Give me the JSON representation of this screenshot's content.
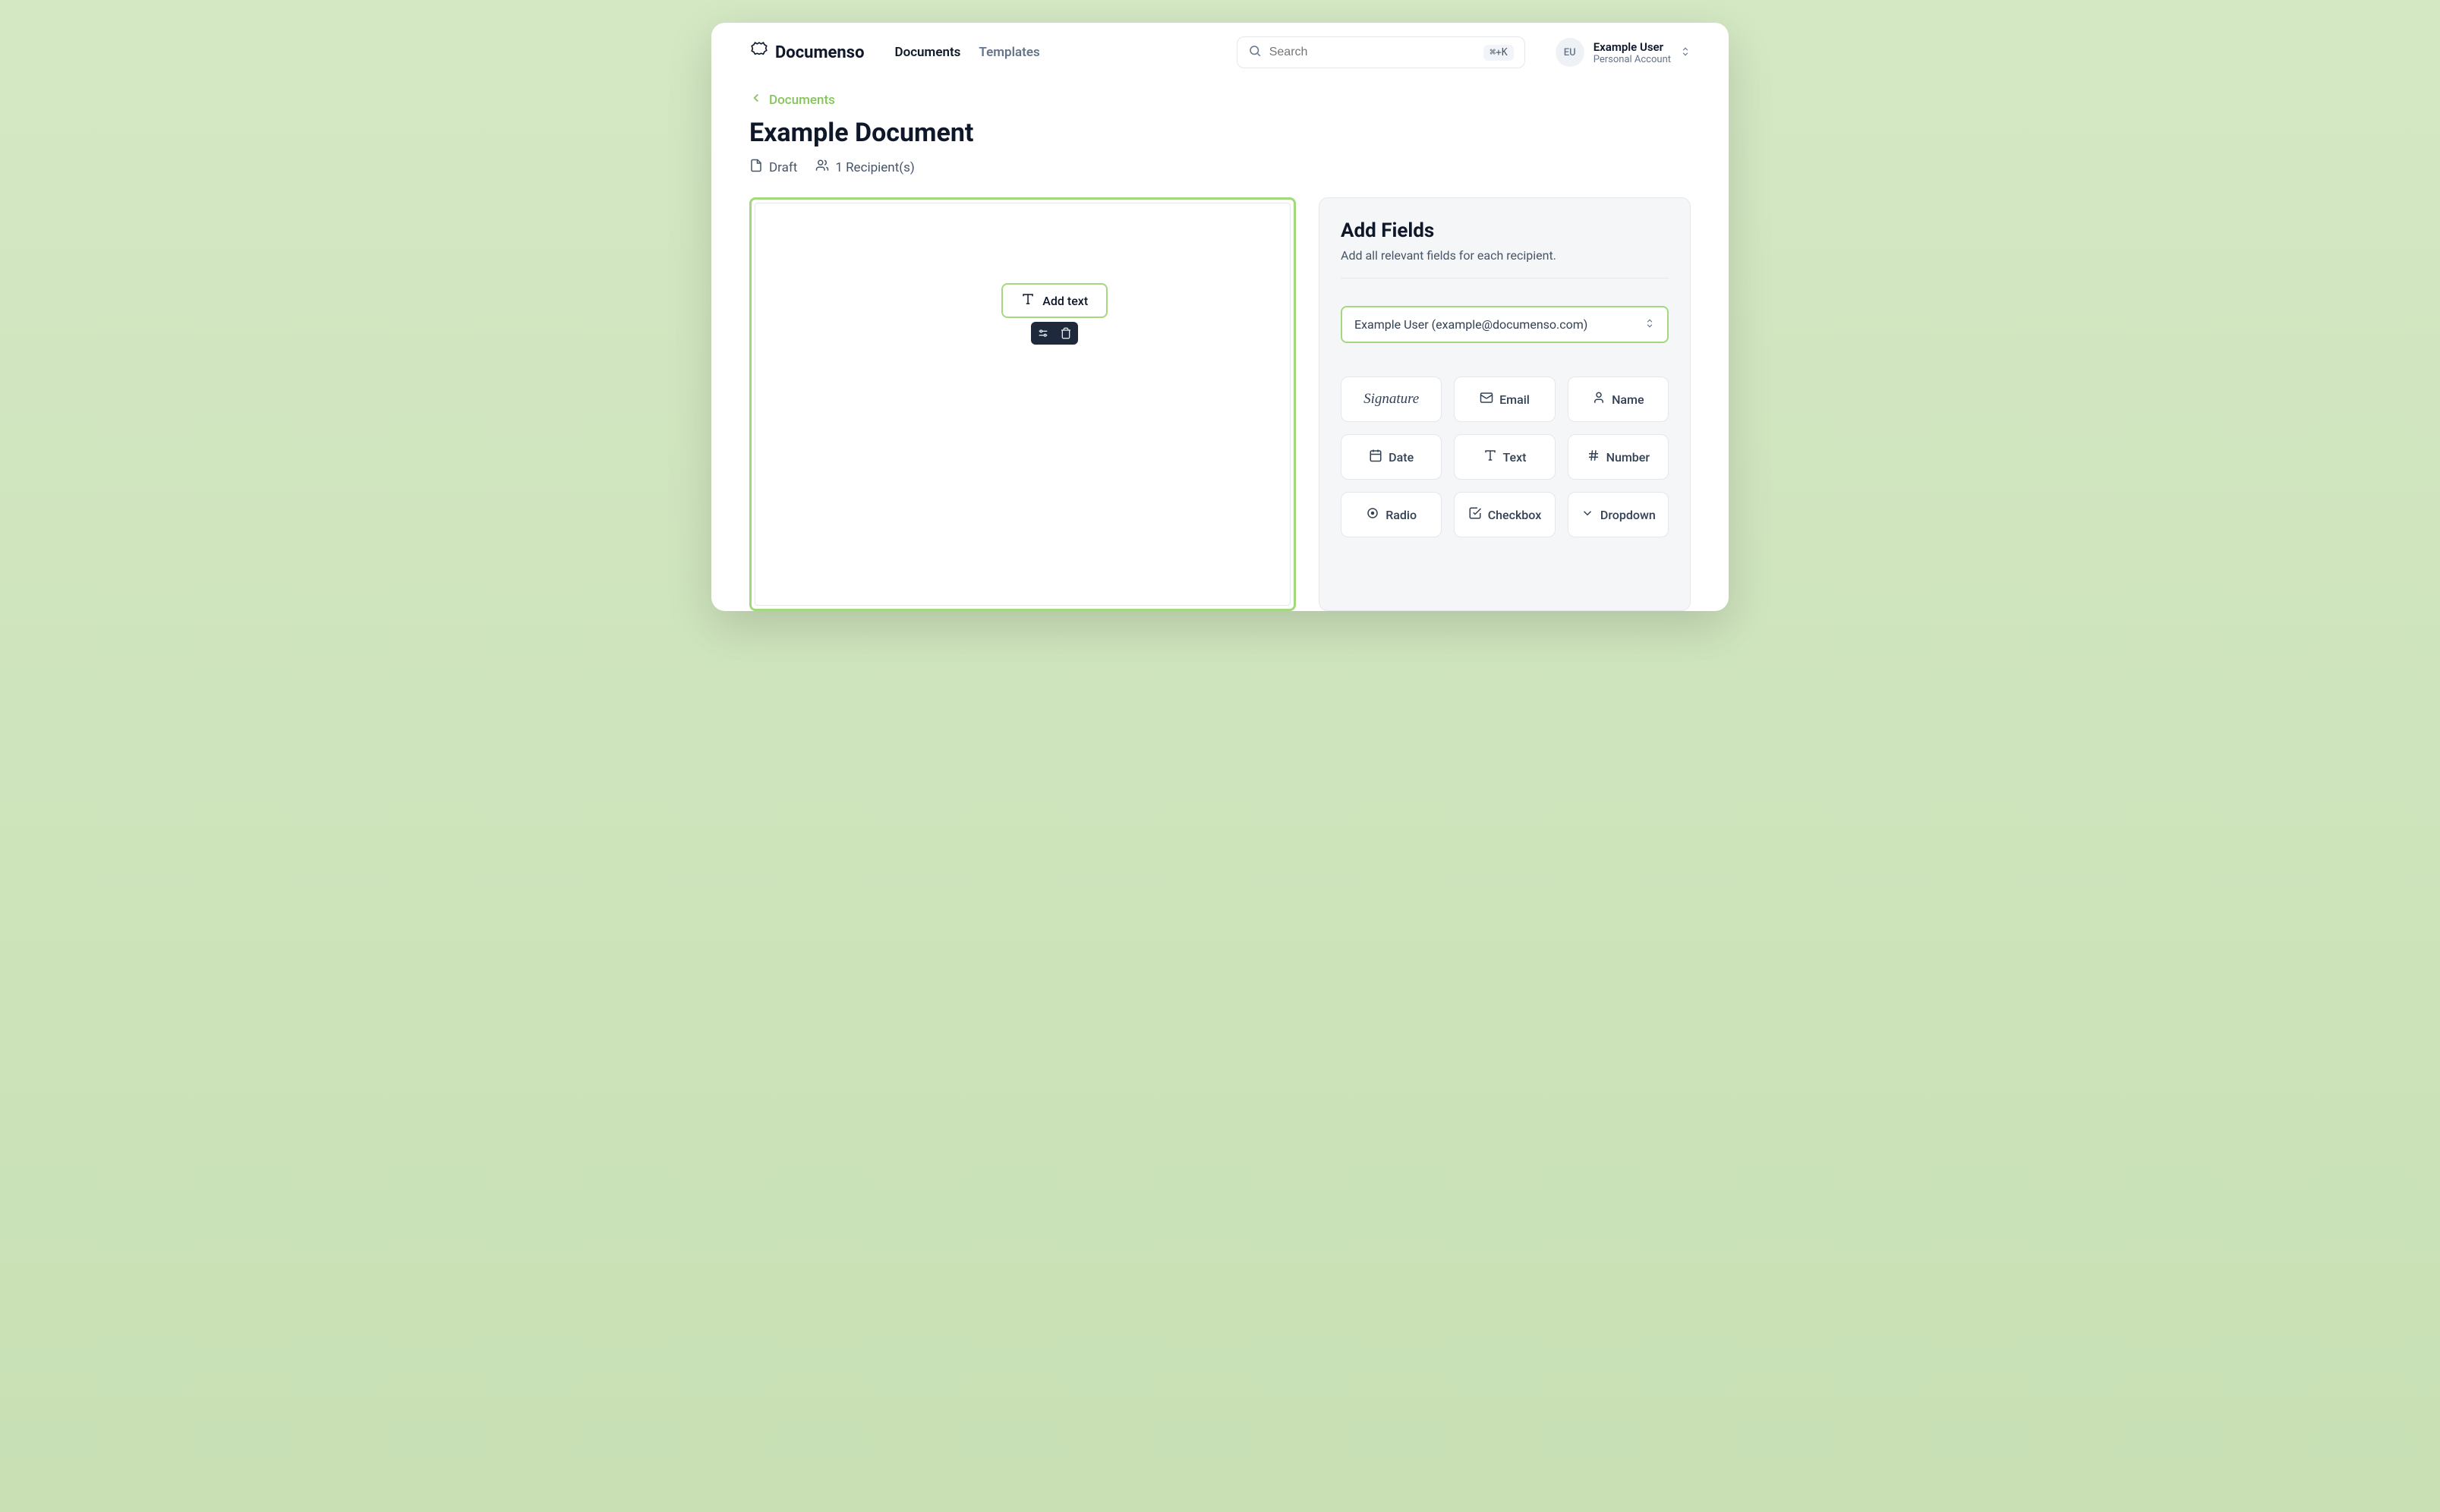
{
  "brand": {
    "name": "Documenso"
  },
  "nav": {
    "documents": "Documents",
    "templates": "Templates"
  },
  "search": {
    "placeholder": "Search",
    "shortcut": "⌘+K"
  },
  "user": {
    "initials": "EU",
    "name": "Example User",
    "account_label": "Personal Account"
  },
  "breadcrumb": {
    "back_label": "Documents"
  },
  "document": {
    "title": "Example Document",
    "status": "Draft",
    "recipients_label": "1 Recipient(s)"
  },
  "placed_field": {
    "label": "Add text"
  },
  "panel": {
    "title": "Add Fields",
    "subtitle": "Add all relevant fields for each recipient.",
    "recipient_selected": "Example User (example@documenso.com)"
  },
  "field_options": {
    "signature": "Signature",
    "email": "Email",
    "name": "Name",
    "date": "Date",
    "text": "Text",
    "number": "Number",
    "radio": "Radio",
    "checkbox": "Checkbox",
    "dropdown": "Dropdown"
  }
}
